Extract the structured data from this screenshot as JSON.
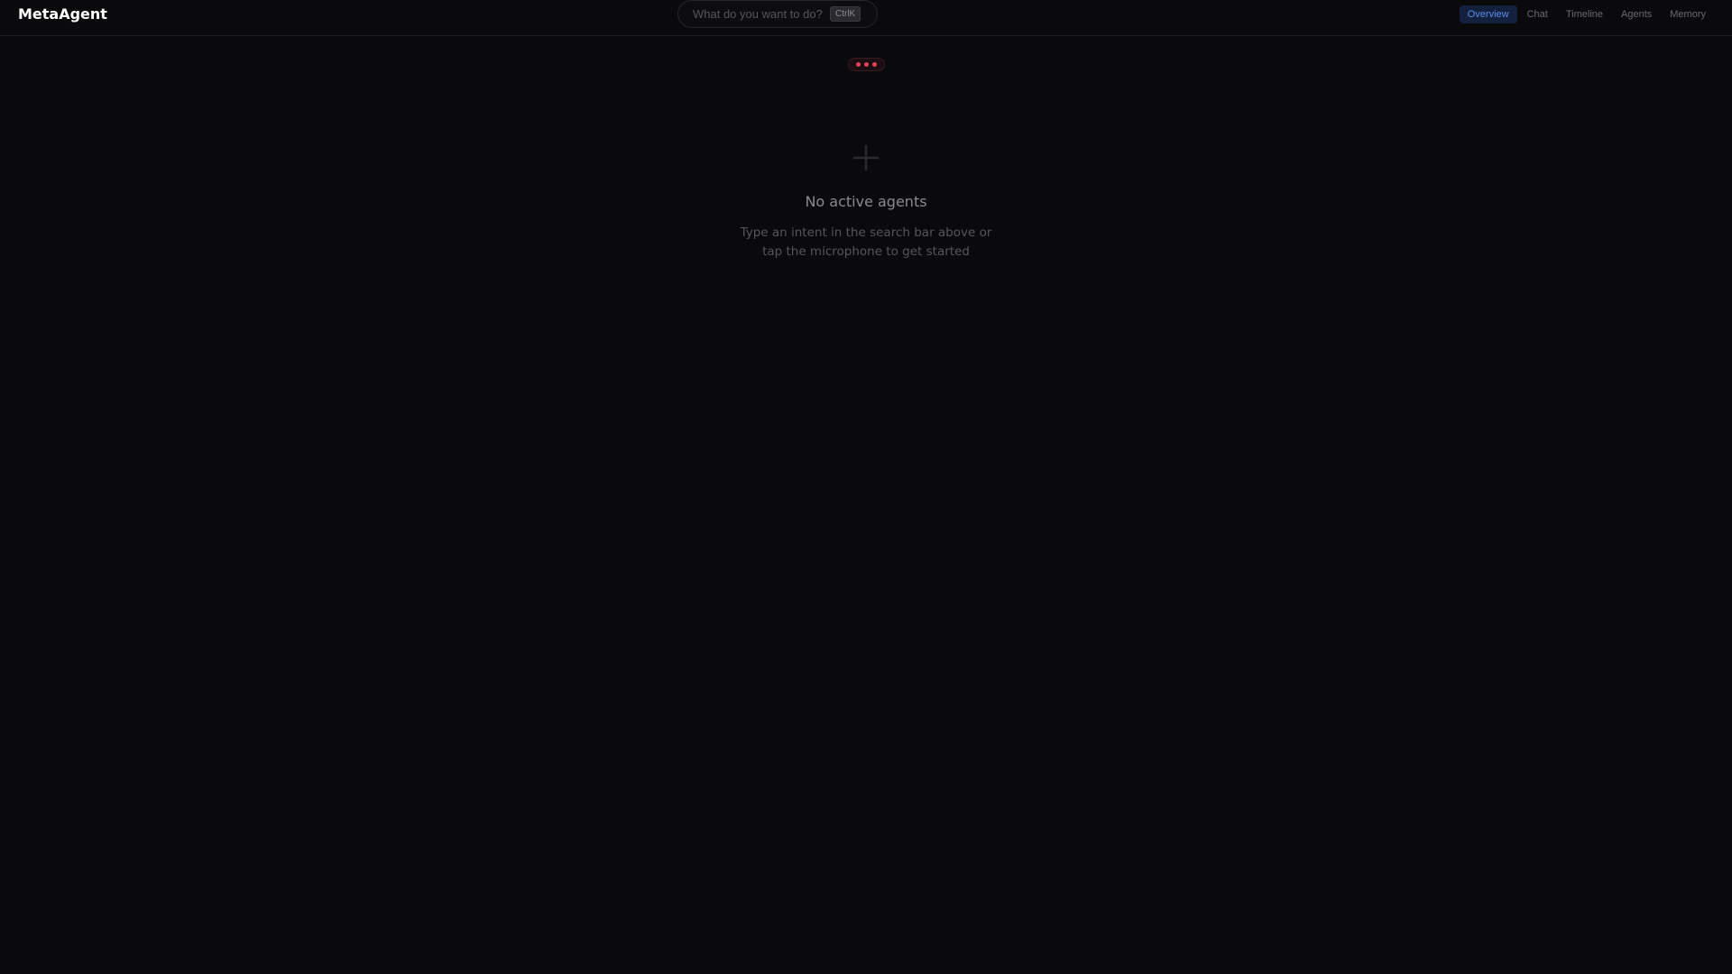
{
  "app": {
    "title": "MetaAgent"
  },
  "search": {
    "placeholder": "What do you want to do?",
    "value": "",
    "shortcut": "CtrlK"
  },
  "nav": {
    "tabs": [
      {
        "label": "Overview",
        "active": true
      },
      {
        "label": "Chat",
        "active": false
      },
      {
        "label": "Timeline",
        "active": false
      },
      {
        "label": "Agents",
        "active": false
      },
      {
        "label": "Memory",
        "active": false
      }
    ]
  },
  "status": {
    "indicator_icon": "three-dots-icon",
    "dot_color": "#e5405a"
  },
  "empty_state": {
    "icon": "plus-icon",
    "title": "No active agents",
    "subtitle": "Type an intent in the search bar above or tap the microphone to get started"
  },
  "colors": {
    "background": "#0a0a0c",
    "accent": "#5c8ee8",
    "active_tab_bg": "#13213e"
  }
}
